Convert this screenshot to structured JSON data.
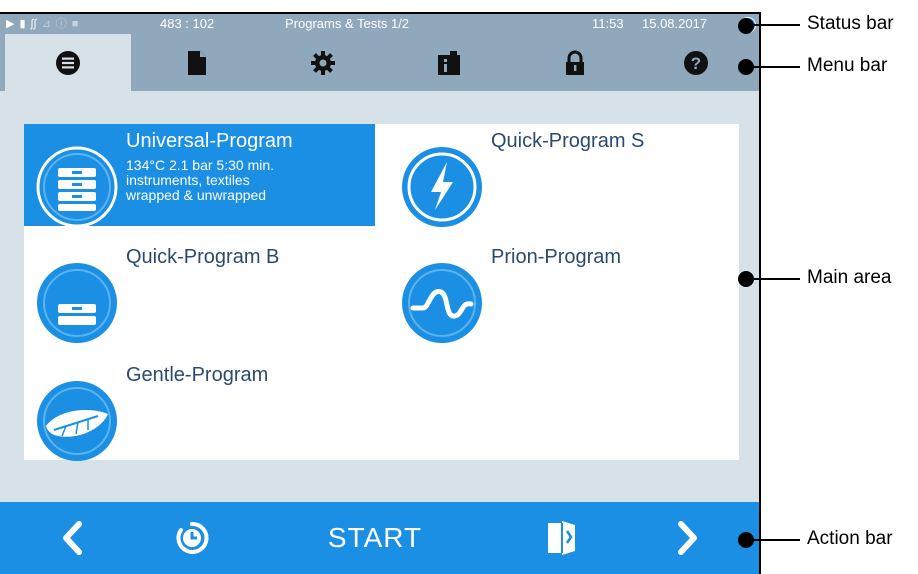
{
  "status_bar": {
    "counter": "483 : 102",
    "title": "Programs & Tests 1/2",
    "time": "11:53",
    "date": "15.08.2017",
    "icons": [
      "play-icon",
      "document-icon",
      "steam-icon",
      "chart-icon",
      "info-icon",
      "lock-icon"
    ]
  },
  "menu_bar": {
    "tabs": [
      {
        "icon": "list-icon",
        "active": true
      },
      {
        "icon": "document-icon",
        "active": false
      },
      {
        "icon": "gear-icon",
        "active": false
      },
      {
        "icon": "info-clipboard-icon",
        "active": false
      },
      {
        "icon": "lock-icon",
        "active": false
      },
      {
        "icon": "help-icon",
        "active": false
      }
    ]
  },
  "programs": [
    {
      "name": "Universal-Program",
      "selected": true,
      "details": [
        "134°C 2.1 bar 5:30 min.",
        "instruments, textiles",
        "wrapped & unwrapped"
      ],
      "icon": "stack-icon"
    },
    {
      "name": "Quick-Program S",
      "selected": false,
      "details": [],
      "icon": "lightning-icon"
    },
    {
      "name": "Quick-Program B",
      "selected": false,
      "details": [],
      "icon": "tray-icon"
    },
    {
      "name": "Prion-Program",
      "selected": false,
      "details": [],
      "icon": "wave-icon"
    },
    {
      "name": "Gentle-Program",
      "selected": false,
      "details": [],
      "icon": "feather-icon"
    }
  ],
  "action_bar": {
    "start_label": "START"
  },
  "annotations": {
    "status_bar": "Status bar",
    "menu_bar": "Menu bar",
    "main_area": "Main area",
    "action_bar": "Action bar"
  },
  "colors": {
    "accent": "#1a8fe3",
    "bar_grey": "#8fa8bb",
    "background": "#d7e1e8",
    "program_text": "#2b4a70"
  }
}
